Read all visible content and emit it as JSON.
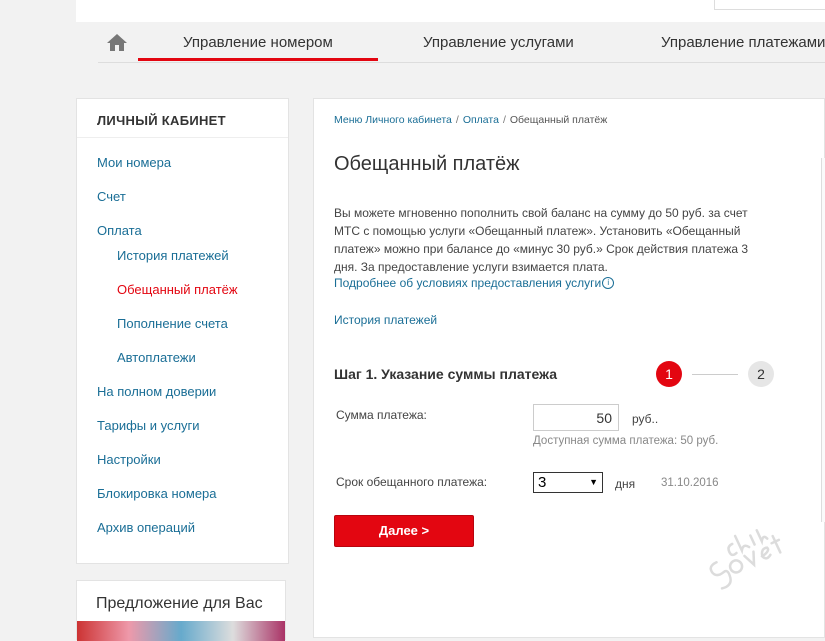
{
  "nav": {
    "tabs": [
      "Управление номером",
      "Управление услугами",
      "Управление платежами"
    ],
    "active_tab": 0
  },
  "sidebar": {
    "title": "ЛИЧНЫЙ КАБИНЕТ",
    "items": [
      {
        "label": "Мои номера"
      },
      {
        "label": "Счет"
      },
      {
        "label": "Оплата"
      },
      {
        "label": "История платежей"
      },
      {
        "label": "Обещанный платёж"
      },
      {
        "label": "Пополнение счета"
      },
      {
        "label": "Автоплатежи"
      },
      {
        "label": "На полном доверии"
      },
      {
        "label": "Тарифы и услуги"
      },
      {
        "label": "Настройки"
      },
      {
        "label": "Блокировка номера"
      },
      {
        "label": "Архив операций"
      }
    ]
  },
  "offer": {
    "title": "Предложение для Вас"
  },
  "breadcrumb": {
    "items": [
      "Меню Личного кабинета",
      "Оплата",
      "Обещанный платёж"
    ],
    "separator": "/"
  },
  "page": {
    "title": "Обещанный платёж",
    "description": "Вы можете мгновенно пополнить свой баланс на сумму до 50 руб. за счет МТС с помощью услуги «Обещанный платеж». Установить «Обещанный платеж» можно при балансе до «минус 30 руб.» Срок действия платежа 3 дня. За предоставление услуги взимается плата.",
    "more_link": "Подробнее об условиях предоставления услуги",
    "info_glyph": "i",
    "history_link": "История платежей"
  },
  "step": {
    "title": "Шаг 1. Указание суммы платежа",
    "current": "1",
    "next": "2"
  },
  "form": {
    "amount_label": "Сумма платежа:",
    "amount_value": "50",
    "amount_unit": "руб..",
    "amount_hint": "Доступная сумма платежа: 50 руб.",
    "term_label": "Срок обещанного платежа:",
    "term_value": "3",
    "term_arrow": "▼",
    "term_unit": "дня",
    "term_date": "31.10.2016",
    "next_button": "Далее >"
  },
  "colors": {
    "accent": "#e30611",
    "link": "#1a6e96"
  },
  "icons": {
    "home": "home-icon",
    "info": "info-icon",
    "dropdown": "chevron-down-icon"
  }
}
